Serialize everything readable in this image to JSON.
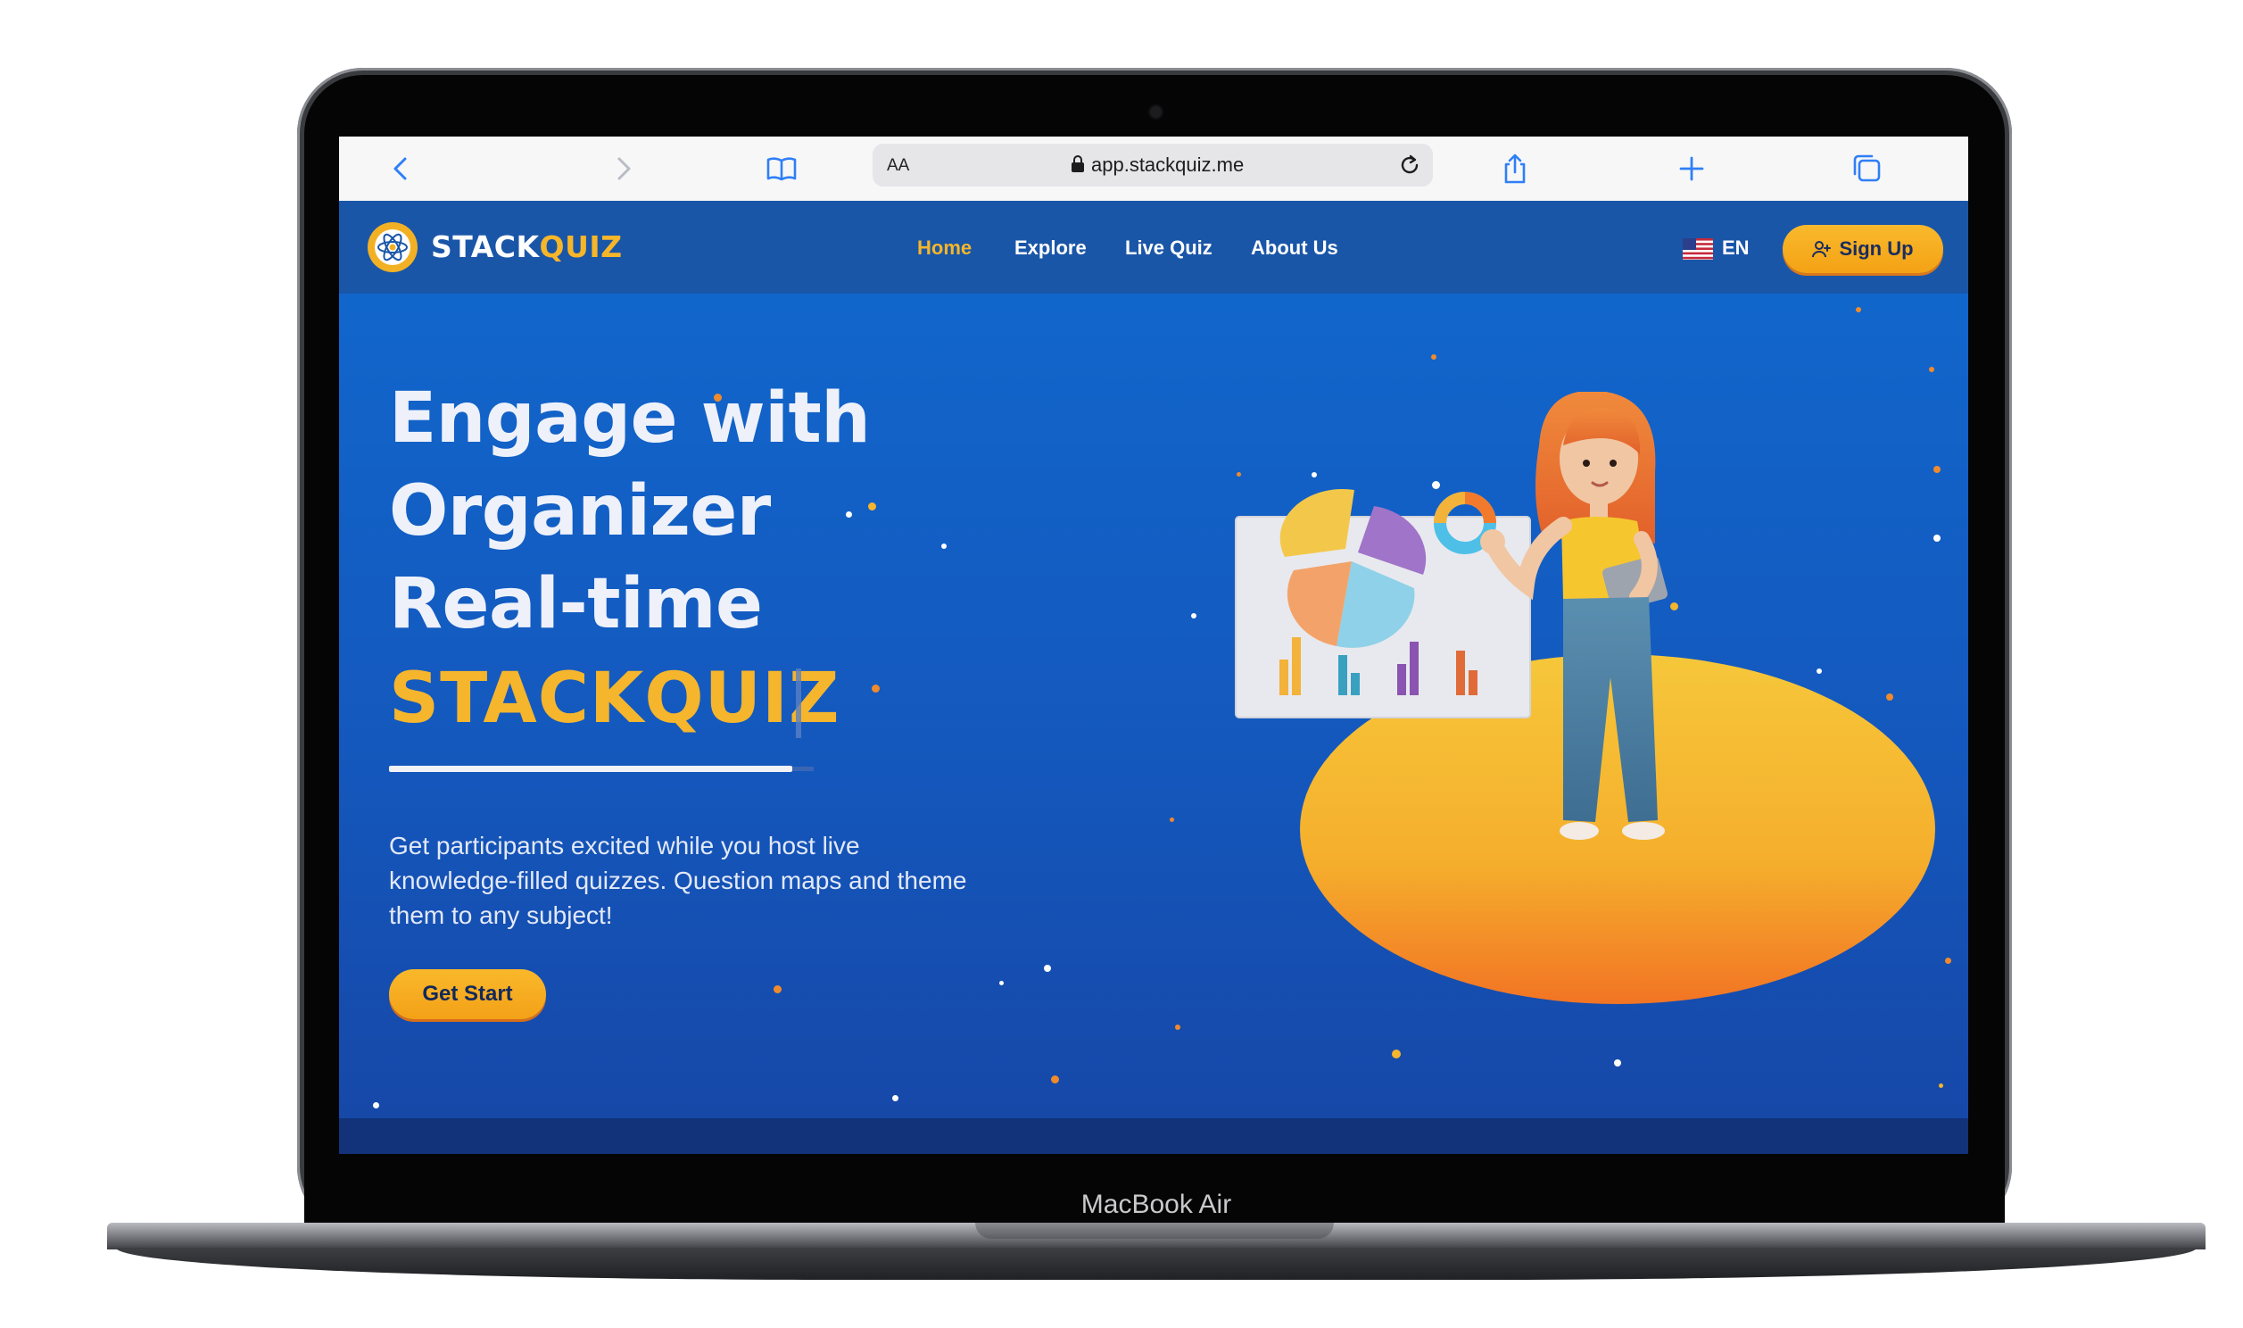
{
  "device": {
    "label": "MacBook Air"
  },
  "browser": {
    "address_aa": "AA",
    "url": "app.stackquiz.me"
  },
  "nav": {
    "brand_a": "STACK",
    "brand_b": "QUIZ",
    "links": [
      "Home",
      "Explore",
      "Live Quiz",
      "About Us"
    ],
    "active": "Home",
    "lang": "EN",
    "signup": "Sign Up"
  },
  "hero": {
    "lines": [
      "Engage with",
      "Organizer",
      "Real-time"
    ],
    "brand": "STACKQUIZ",
    "description": [
      "Get participants excited while you host live",
      "knowledge-filled quizzes. Question maps and theme",
      "them to any subject!"
    ],
    "cta": "Get Start"
  },
  "colors": {
    "accent": "#f6b62a",
    "nav_bg": "#1a56a8",
    "hero_bg": "#1166cc",
    "safari_icon": "#2f7ff6"
  },
  "icons": [
    "back-icon",
    "forward-icon",
    "bookmarks-icon",
    "lock-icon",
    "reload-icon",
    "share-icon",
    "new-tab-icon",
    "tabs-icon",
    "atom-logo-icon",
    "us-flag-icon",
    "add-user-icon"
  ]
}
